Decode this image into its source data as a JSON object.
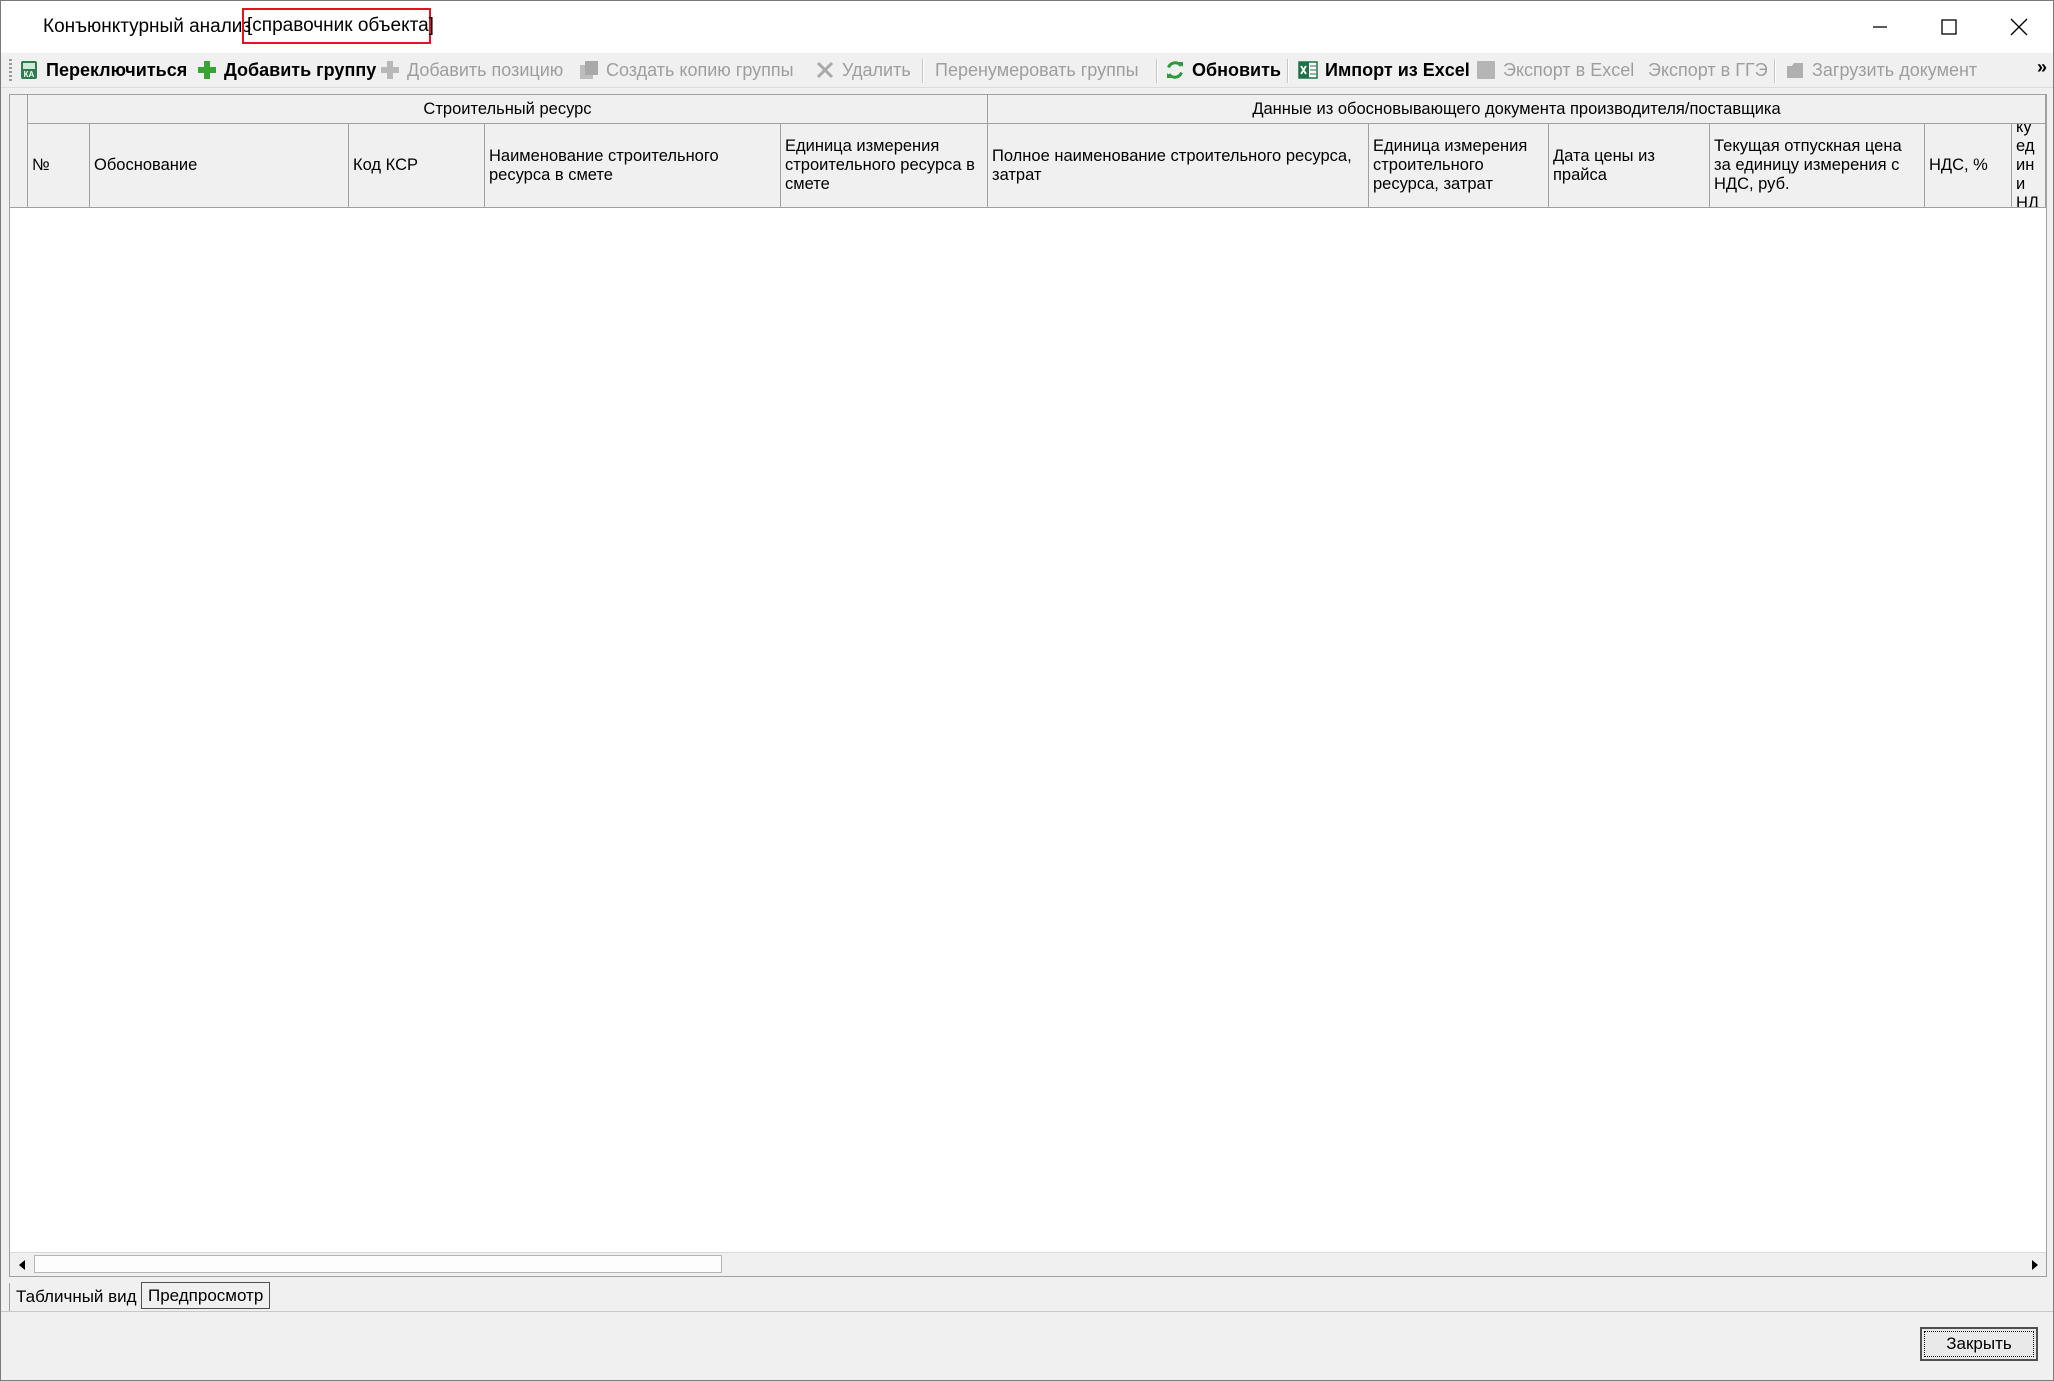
{
  "window": {
    "title": "Конъюнктурный анализ",
    "title_tag": "[справочник объекта]"
  },
  "toolbar": {
    "items": [
      {
        "label": "Переключиться",
        "icon": "switch-ka-icon",
        "enabled": true
      },
      {
        "label": "Добавить группу",
        "icon": "plus-icon",
        "enabled": true
      },
      {
        "label": "Добавить позицию",
        "icon": "plus-icon",
        "enabled": false
      },
      {
        "label": "Создать копию группы",
        "icon": "copy-icon",
        "enabled": false
      },
      {
        "label": "Удалить",
        "icon": "delete-x-icon",
        "enabled": false
      },
      {
        "label": "Перенумеровать группы",
        "icon": "",
        "enabled": false
      },
      {
        "label": "Обновить",
        "icon": "refresh-icon",
        "enabled": true
      },
      {
        "label": "Импорт из Excel",
        "icon": "excel-icon",
        "enabled": true
      },
      {
        "label": "Экспорт в Excel",
        "icon": "export-icon",
        "enabled": false
      },
      {
        "label": "Экспорт в ГГЭ",
        "icon": "",
        "enabled": false
      },
      {
        "label": "Загрузить документ",
        "icon": "document-icon",
        "enabled": false
      }
    ],
    "overflow": "»"
  },
  "grid": {
    "group_headers": [
      "Строительный ресурс",
      "Данные из обосновывающего документа производителя/поставщика"
    ],
    "columns": [
      "№",
      "Обоснование",
      "Код КСР",
      "Наименование строительного ресурса в смете",
      "Единица измерения строительного ресурса в смете",
      "Полное наименование строительного ресурса, затрат",
      "Единица измерения строительного ресурса, затрат",
      "Дата цены из прайса",
      "Текущая отпускная цена за единицу измерения с НДС, руб.",
      "НДС, %",
      "Теку едини НДС,"
    ],
    "rows": []
  },
  "tabs": [
    {
      "label": "Табличный вид",
      "active": true
    },
    {
      "label": "Предпросмотр",
      "active": false
    }
  ],
  "footer": {
    "close_label": "Закрыть"
  },
  "colors": {
    "highlight": "#e81123",
    "chrome": "#f0f0f0",
    "disabled_text": "#9e9e9e",
    "plus_green": "#3aa336",
    "refresh_green": "#2e9a3b",
    "excel_green": "#1f7244"
  }
}
